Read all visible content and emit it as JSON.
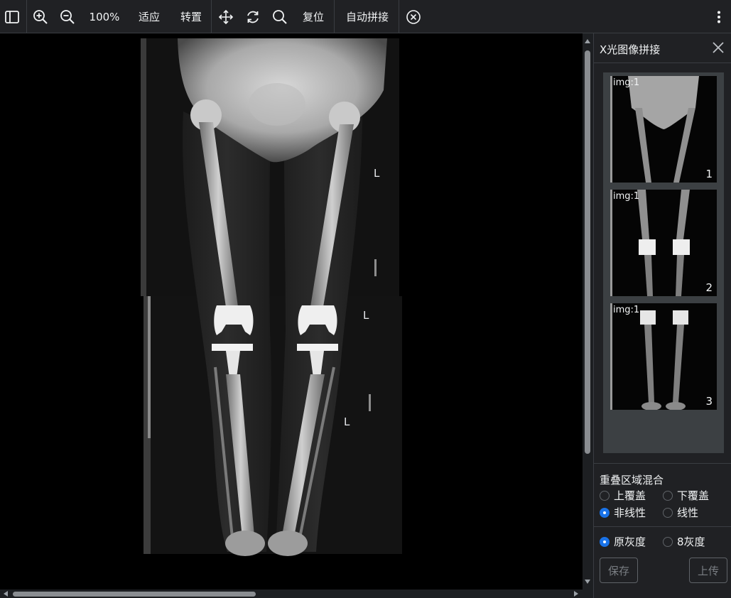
{
  "toolbar": {
    "zoom_level": "100%",
    "fit_label": "适应",
    "rotate_label": "转置",
    "reset_label": "复位",
    "auto_stitch_label": "自动拼接"
  },
  "viewer": {
    "markers": [
      "L",
      "L",
      "L"
    ]
  },
  "panel": {
    "title": "X光图像拼接",
    "thumbnails": [
      {
        "label": "img:1",
        "number": "1"
      },
      {
        "label": "img:1",
        "number": "2"
      },
      {
        "label": "img:1",
        "number": "3"
      }
    ],
    "overlap_title": "重叠区域混合",
    "overlap_options": [
      {
        "label": "上覆盖",
        "selected": false
      },
      {
        "label": "下覆盖",
        "selected": false
      },
      {
        "label": "非线性",
        "selected": true
      },
      {
        "label": "线性",
        "selected": false
      }
    ],
    "gray_options": [
      {
        "label": "原灰度",
        "selected": true
      },
      {
        "label": "8灰度",
        "selected": false
      }
    ],
    "save_label": "保存",
    "upload_label": "上传"
  },
  "colors": {
    "toolbar_bg": "#202124",
    "panel_bg": "#202124",
    "accent": "#1a73e8"
  }
}
